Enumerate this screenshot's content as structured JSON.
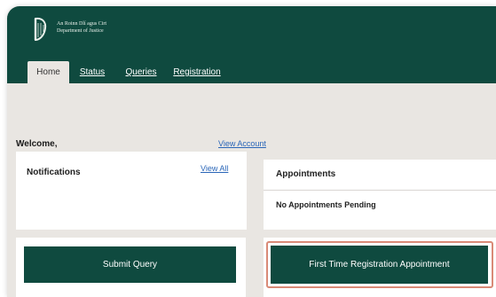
{
  "header": {
    "org_line1": "An Roinn Dlí agus Cirt",
    "org_line2": "Department of Justice",
    "logo": "harp-icon"
  },
  "tabs": [
    {
      "label": "Home",
      "active": true
    },
    {
      "label": "Status",
      "active": false
    },
    {
      "label": "Queries",
      "active": false
    },
    {
      "label": "Registration",
      "active": false
    }
  ],
  "welcome": {
    "text": "Welcome,",
    "view_account": "View Account"
  },
  "notifications": {
    "title": "Notifications",
    "view_all": "View All"
  },
  "appointments": {
    "title": "Appointments",
    "status": "No Appointments Pending"
  },
  "actions": {
    "submit_query": "Submit Query",
    "first_time_registration": "First Time Registration Appointment"
  },
  "colors": {
    "brand_green": "#0f4a3f",
    "link_blue": "#2a66b8",
    "highlight": "#d98a77",
    "page_bg": "#e9e6e2"
  }
}
